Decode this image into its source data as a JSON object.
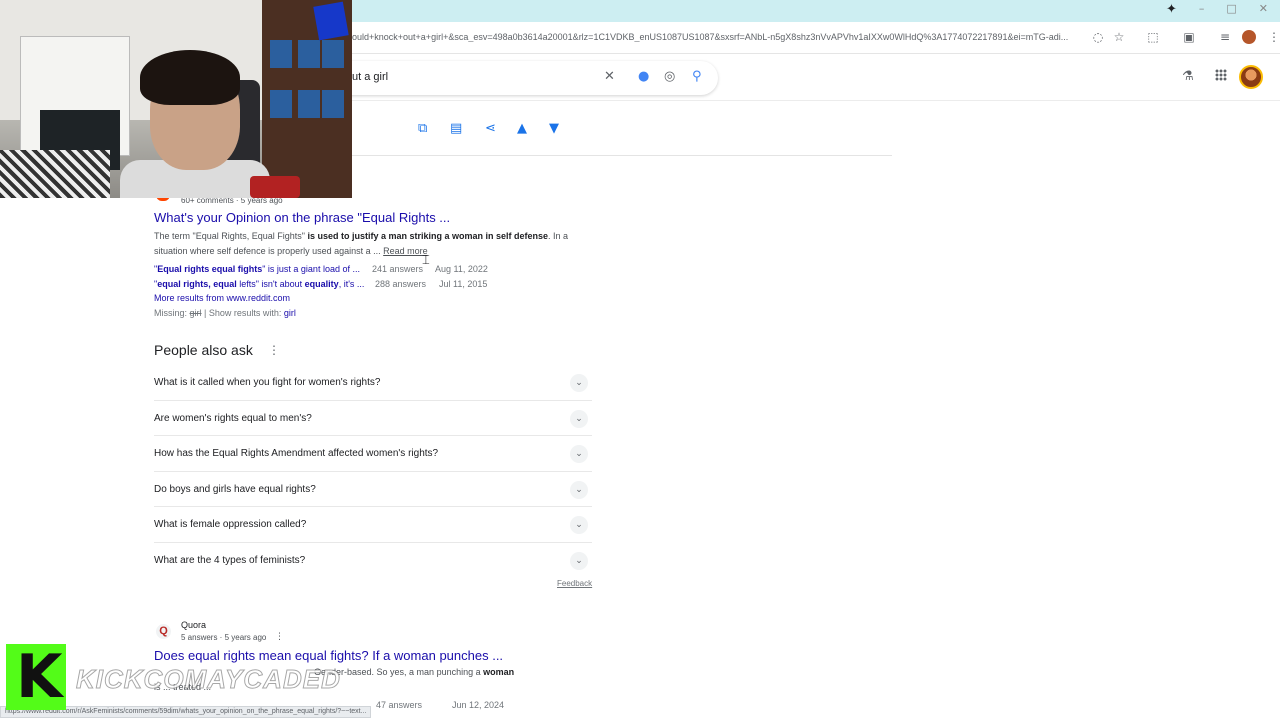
{
  "browser": {
    "url": "ould+knock+out+a+girl+&sca_esv=498a0b3614a20001&rlz=1C1VDKB_enUS1087US1087&sxsrf=ANbL-n5gX8shz3nVvAPVhv1aIXXw0WlHdQ%3A1774072217891&ei=mTG-adi...",
    "status_url": "https://www.reddit.com/r/AskFeminists/comments/59dim/whats_your_opinion_on_the_phrase_equal_rights/?~~text..."
  },
  "search": {
    "query": "ut a girl"
  },
  "result_reddit": {
    "meta": "60+ comments · 5 years ago",
    "title": "What's your Opinion on the phrase \"Equal Rights ...",
    "snippet_pre": "The term \"Equal Rights, Equal Fights\" ",
    "snippet_bold": "is used to justify a man striking a woman in self defense",
    "snippet_post": ". In a situation where self defence is properly used against a ...",
    "read_more": "Read more",
    "sub": [
      {
        "pre": "\"",
        "bold": "Equal rights equal fights",
        "post": "\" is just a giant load of ...",
        "answers": "241 answers",
        "date": "Aug 11, 2022"
      },
      {
        "pre": "\"",
        "bold": "equal rights, equal",
        "post": " lefts\" isn't about ",
        "bold2": "equality",
        "post2": ", it's ...",
        "answers": "288 answers",
        "date": "Jul 11, 2015"
      }
    ],
    "more_results": "More results from www.reddit.com",
    "missing_label": "Missing: ",
    "missing_word": "girl",
    "show_results_label": " | Show results with: ",
    "show_results_word": "girl"
  },
  "paa": {
    "title": "People also ask",
    "questions": [
      "What is it called when you fight for women's rights?",
      "Are women's rights equal to men's?",
      "How has the Equal Rights Amendment affected women's rights?",
      "Do boys and girls have equal rights?",
      "What is female oppression called?",
      "What are the 4 types of feminists?"
    ],
    "feedback": "Feedback"
  },
  "result_quora": {
    "source": "Quora",
    "meta": "5 answers · 5 years ago",
    "title": "Does equal rights mean equal fights? If a woman punches ...",
    "snippet1_pre": "Gender-based. So yes, a man punching a ",
    "snippet1_bold": "woman",
    "snippet2": "is ... treated ...",
    "sub_answers": "47 answers",
    "sub_date": "Jun 12, 2024"
  },
  "overlay": {
    "handle": "KICKCOMAYCADED"
  },
  "icons": {
    "sparkle": "sparkle-icon",
    "clear": "close-icon",
    "mic": "microphone-icon",
    "lens": "lens-icon",
    "search": "search-icon",
    "labs": "flask-icon",
    "apps": "apps-grid-icon"
  },
  "colors": {
    "link": "#1a0dab",
    "accent": "#1a73e8",
    "titlebar": "#cdeef2",
    "kick": "#53fc18"
  }
}
